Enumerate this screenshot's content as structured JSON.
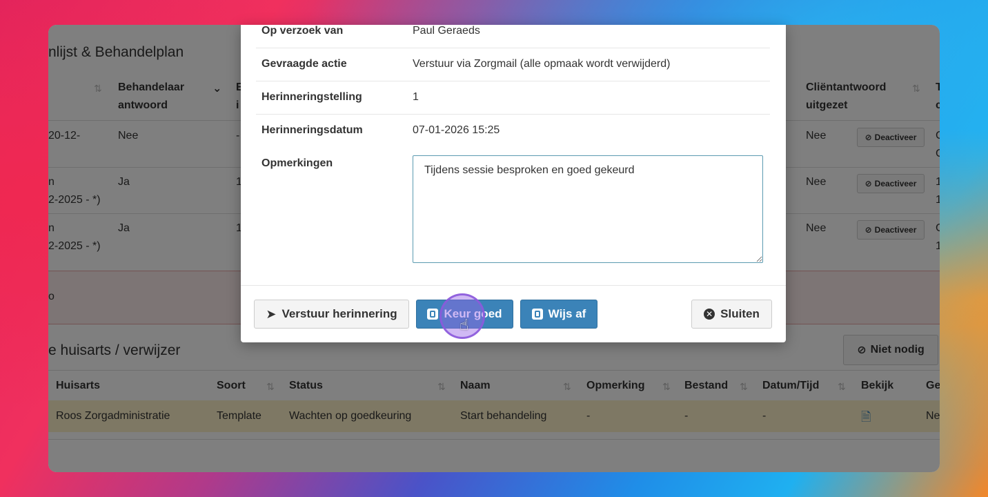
{
  "background": {
    "title_top": "nlijst & Behandelplan",
    "title_bottom": "e huisarts / verwijzer",
    "top_headers": {
      "behandelaar": "Behandelaar",
      "antwoord": "antwoord",
      "e_frag": "E",
      "i_frag": "i",
      "client": "Cliëntantwoord",
      "uitgezet": "uitgezet",
      "t_frag": "T",
      "c_frag": "c"
    },
    "top_rows": [
      {
        "left_a": "20-12-",
        "left_b": "",
        "answer": "Nee",
        "e": "-",
        "client": "Nee",
        "t1": "C",
        "t2": "C"
      },
      {
        "left_a": "n",
        "left_b": "2-2025 - *)",
        "answer": "Ja",
        "e": "1",
        "client": "Nee",
        "t1": "1",
        "t2": "1"
      },
      {
        "left_a": "n",
        "left_b": "2-2025 - *)",
        "answer": "Ja",
        "e": "1",
        "client": "Nee",
        "t1": "C",
        "t2": "1"
      }
    ],
    "deactiveer_label": "Deactiveer",
    "red_row_text": "o",
    "niet_nodig_label": "Niet nodig",
    "bottom_headers": {
      "huisarts": "Huisarts",
      "soort": "Soort",
      "status": "Status",
      "naam": "Naam",
      "opmerking": "Opmerking",
      "bestand": "Bestand",
      "datum": "Datum/Tijd",
      "bekijk": "Bekijk",
      "ge": "Ge"
    },
    "bottom_row": {
      "huisarts": "Roos Zorgadministratie",
      "soort": "Template",
      "status": "Wachten op goedkeuring",
      "naam": "Start behandeling",
      "opmerking": "-",
      "bestand": "-",
      "datum": "-",
      "ge": "Ne"
    }
  },
  "modal": {
    "fields": [
      {
        "label": "Op verzoek van",
        "value": "Paul Geraeds"
      },
      {
        "label": "Gevraagde actie",
        "value": "Verstuur via Zorgmail (alle opmaak wordt verwijderd)"
      },
      {
        "label": "Herinneringstelling",
        "value": "1"
      },
      {
        "label": "Herinneringsdatum",
        "value": "07-01-2026 15:25"
      }
    ],
    "remarks_label": "Opmerkingen",
    "remarks_value": "Tijdens sessie besproken en goed gekeurd",
    "buttons": {
      "send_reminder": "Verstuur herinnering",
      "approve": "Keur goed",
      "reject": "Wijs af",
      "close": "Sluiten"
    }
  },
  "colors": {
    "primary": "#3b83b8",
    "highlight_row": "#fcf0c8",
    "cursor": "#9664e6"
  }
}
